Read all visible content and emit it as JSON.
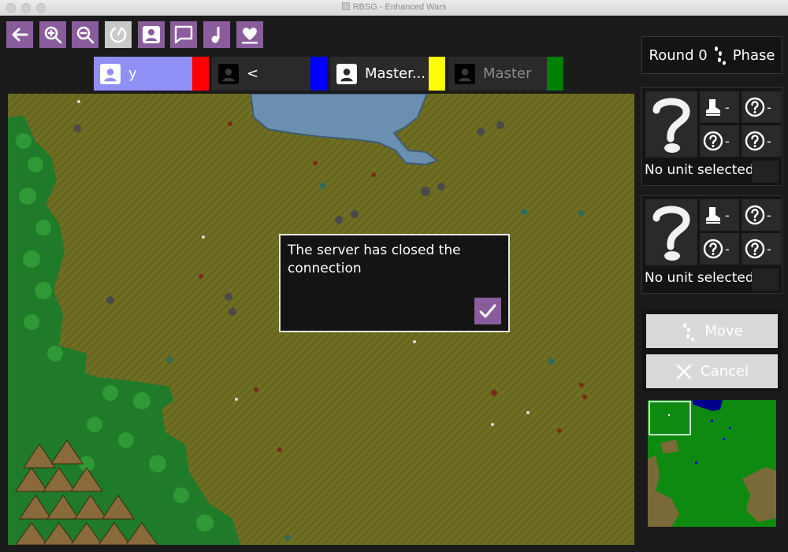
{
  "window": {
    "title": "RBSG - Enhanced Wars"
  },
  "toolbar": [
    {
      "name": "back-icon"
    },
    {
      "name": "zoom-in-icon"
    },
    {
      "name": "zoom-out-icon"
    },
    {
      "name": "end-turn-icon",
      "disabled": true
    },
    {
      "name": "player-icon"
    },
    {
      "name": "chat-icon"
    },
    {
      "name": "music-icon"
    },
    {
      "name": "health-icon"
    }
  ],
  "players": [
    {
      "name": "y",
      "color": "#ff0000",
      "active": true
    },
    {
      "name": "<",
      "color": "#0000ff",
      "active": false
    },
    {
      "name": "Master...",
      "color": "#ffff00",
      "active": false
    },
    {
      "name": "Master",
      "color": "#008000",
      "active": false
    }
  ],
  "status": {
    "round_label": "Round 0",
    "phase_label": "Phase"
  },
  "unit_panels": [
    {
      "label": "No unit selected",
      "stats": [
        "-",
        "-",
        "-",
        "-"
      ]
    },
    {
      "label": "No unit selected",
      "stats": [
        "-",
        "-",
        "-",
        "-"
      ]
    }
  ],
  "actions": {
    "move_label": "Move",
    "cancel_label": "Cancel"
  },
  "dialog": {
    "message": "The server has closed the connection"
  },
  "colors": {
    "accent": "#8a5c9c",
    "grass": "#6b6a1e",
    "forest": "#1f7a2a",
    "water": "#6b8fb0"
  }
}
